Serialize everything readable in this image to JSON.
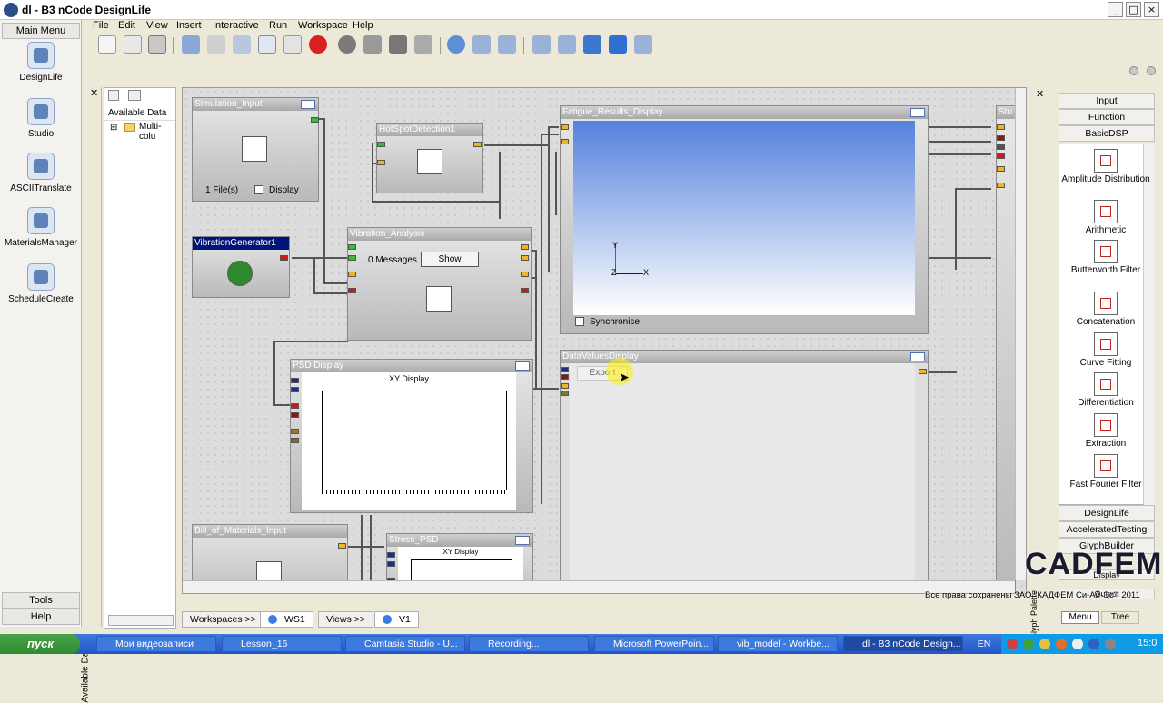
{
  "window": {
    "title": "dl - B3 nCode DesignLife"
  },
  "menubar": [
    "File",
    "Edit",
    "View",
    "Insert",
    "Interactive",
    "Run",
    "Workspace",
    "Help"
  ],
  "left": {
    "main_menu": "Main Menu",
    "tools": [
      "DesignLife",
      "Studio",
      "ASCIITranslate",
      "MaterialsManager",
      "ScheduleCreate"
    ],
    "bottom_buttons": [
      "Tools",
      "Help"
    ],
    "palette_tab": "Available Data"
  },
  "data_panel": {
    "header": "Available Data",
    "tree_item": "Multi-colu"
  },
  "glyphs": {
    "simulation_input": {
      "title": "Simulation_Input",
      "files": "1 File(s)",
      "display": "Display"
    },
    "hotspot": {
      "title": "HotSpotDetection1"
    },
    "vibgen": {
      "title": "VibrationGenerator1"
    },
    "vib_analysis": {
      "title": "Vibration_Analysis",
      "messages": "0 Messages",
      "show": "Show"
    },
    "psd": {
      "title": "PSD Display",
      "chart_title": "XY Display"
    },
    "bom": {
      "title": "Bill_of_Materials_Input"
    },
    "stress": {
      "title": "Stress_PSD",
      "chart_title": "XY Display"
    },
    "fatigue": {
      "title": "Fatigue_Results_Display",
      "synchronise": "Synchronise",
      "axis_y": "Y",
      "axis_z": "Z",
      "axis_x": "X"
    },
    "datavalues": {
      "title": "DataValuesDisplay",
      "export": "Export"
    },
    "stub": {
      "title": "Stu"
    }
  },
  "palette": {
    "categories_top": [
      "Input",
      "Function",
      "BasicDSP"
    ],
    "items": [
      "Amplitude Distribution",
      "Arithmetic",
      "Butterworth Filter",
      "Concatenation",
      "Curve Fitting",
      "Differentiation",
      "Extraction",
      "Fast Fourier Filter"
    ],
    "categories_bottom": [
      "DesignLife",
      "AcceleratedTesting",
      "GlyphBuilder",
      "Display",
      "Output"
    ],
    "tabs": [
      "Menu",
      "Tree"
    ],
    "vertical_label": "Glyph Palette"
  },
  "bottom_tabs": [
    "Workspaces >>",
    "WS1",
    "Views >>",
    "V1"
  ],
  "watermark": {
    "logo": "CADFEM",
    "text": "Все права сохранены ЗАО \"КАДФЕМ Си-Ай-Эс\", 2011"
  },
  "taskbar": {
    "start": "пуск",
    "tasks": [
      "Мои видеозаписи",
      "Lesson_16",
      "Camtasia Studio - U...",
      "Recording...",
      "Microsoft PowerPoin...",
      "vib_model - Workbe...",
      "dl - B3 nCode Design..."
    ],
    "lang": "EN",
    "clock": "15:0"
  },
  "colors": {
    "accent": "#00157a",
    "port_orange": "#f0b41e",
    "port_green": "#30c030",
    "port_red": "#d01818"
  }
}
